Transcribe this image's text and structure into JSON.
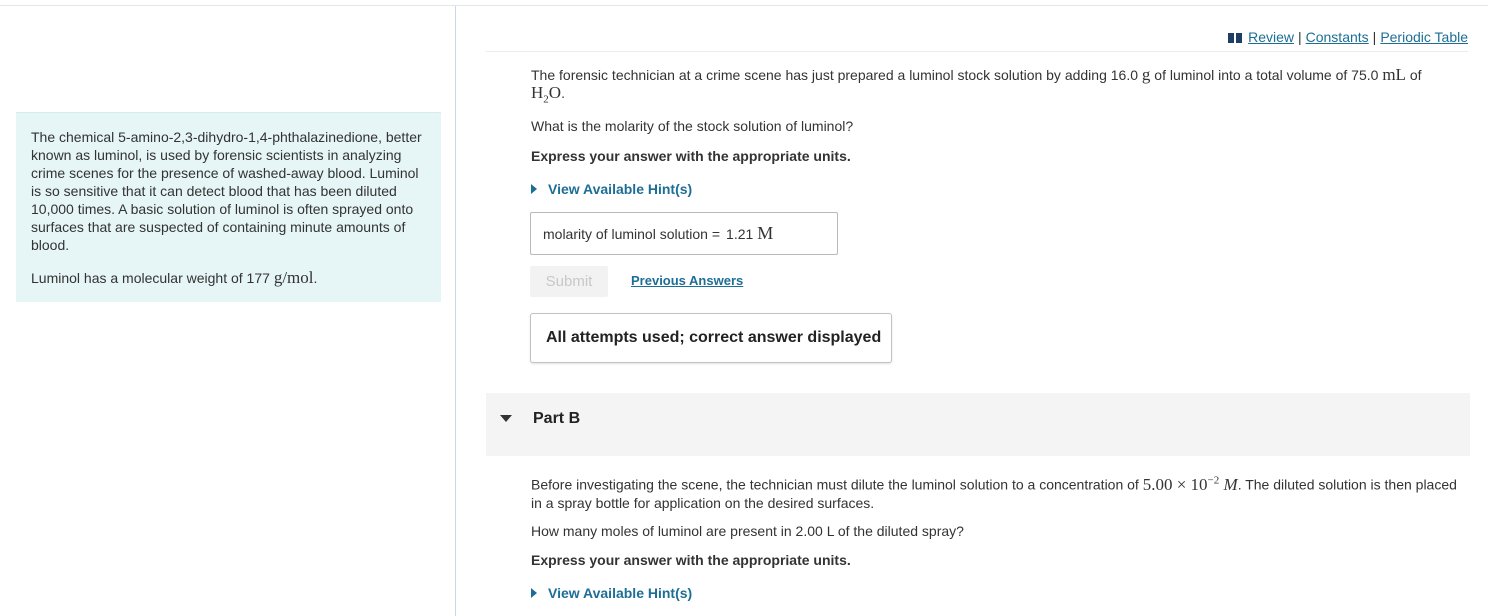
{
  "intro": {
    "paragraph1": "The chemical 5-amino-2,3-dihydro-1,4-phthalazinedione, better known as luminol, is used by forensic scientists in analyzing crime scenes for the presence of washed-away blood. Luminol is so sensitive that it can detect blood that has been diluted 10,000 times. A basic solution of luminol is often sprayed onto surfaces that are suspected of containing minute amounts of blood.",
    "mw_prefix": "Luminol has a molecular weight of 177 ",
    "mw_unit": "g/mol",
    "mw_suffix": "."
  },
  "links": {
    "review": "Review",
    "constants": "Constants",
    "periodic_table": "Periodic Table",
    "separator": "|"
  },
  "part_a": {
    "text_1": "The forensic technician at a crime scene has just prepared a luminol stock solution by adding 16.0 ",
    "unit_g": "g",
    "text_2": " of luminol into a total volume of 75.0 ",
    "unit_ml": "mL",
    "text_3": " of ",
    "formula_h": "H",
    "formula_sub": "2",
    "formula_o": "O",
    "text_4": ".",
    "question": "What is the molarity of the stock solution of luminol?",
    "express": "Express your answer with the appropriate units.",
    "hint": "View Available Hint(s)",
    "answer_label": "molarity of luminol solution =",
    "answer_value": "1.21",
    "answer_unit": "M",
    "submit": "Submit",
    "previous_answers": "Previous Answers",
    "feedback": "All attempts used; correct answer displayed"
  },
  "part_b": {
    "title": "Part B",
    "text_1": "Before investigating the scene, the technician must dilute the luminol solution to a concentration of ",
    "conc_mantissa": "5.00",
    "conc_times": " × 10",
    "conc_exp": "−2",
    "conc_unit": "M",
    "text_2": ". The diluted solution is then placed in a spray bottle for application on the desired surfaces.",
    "question": "How many moles of luminol are present in 2.00 L of the diluted spray?",
    "express": "Express your answer with the appropriate units.",
    "hint": "View Available Hint(s)"
  },
  "colors": {
    "link": "#1d6e96",
    "intro_bg": "#e6f5f6",
    "partb_bg": "#f4f4f4"
  }
}
